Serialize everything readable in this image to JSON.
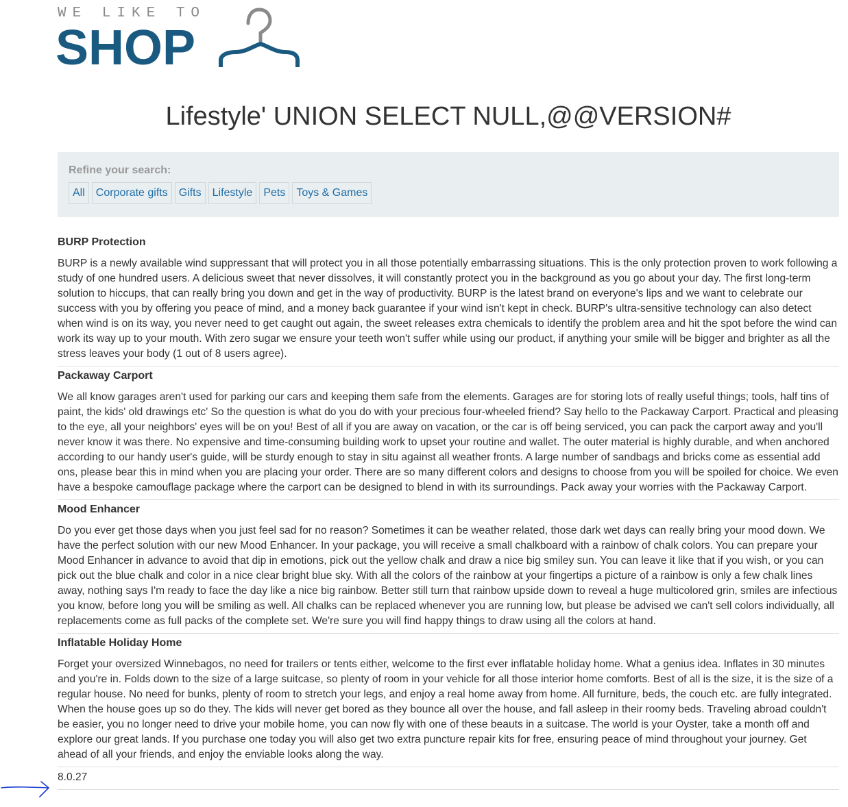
{
  "logo": {
    "tagline": "WE LIKE TO",
    "word": "SHOP"
  },
  "page_title": "Lifestyle' UNION SELECT NULL,@@VERSION#",
  "filter": {
    "heading": "Refine your search:",
    "categories": [
      "All",
      "Corporate gifts",
      "Gifts",
      "Lifestyle",
      "Pets",
      "Toys & Games"
    ]
  },
  "products": [
    {
      "name": "BURP Protection",
      "description": "BURP is a newly available wind suppressant that will protect you in all those potentially embarrassing situations. This is the only protection proven to work following a study of one hundred users. A delicious sweet that never dissolves, it will constantly protect you in the background as you go about your day. The first long-term solution to hiccups, that can really bring you down and get in the way of productivity. BURP is the latest brand on everyone's lips and we want to celebrate our success with you by offering you peace of mind, and a money back guarantee if your wind isn't kept in check. BURP's ultra-sensitive technology can also detect when wind is on its way, you never need to get caught out again, the sweet releases extra chemicals to identify the problem area and hit the spot before the wind can work its way up to your mouth. With zero sugar we ensure your teeth won't suffer while using our product, if anything your smile will be bigger and brighter as all the stress leaves your body (1 out of 8 users agree)."
    },
    {
      "name": "Packaway Carport",
      "description": "We all know garages aren't used for parking our cars and keeping them safe from the elements. Garages are for storing lots of really useful things; tools, half tins of paint, the kids' old drawings etc' So the question is what do you do with your precious four-wheeled friend? Say hello to the Packaway Carport. Practical and pleasing to the eye, all your neighbors' eyes will be on you! Best of all if you are away on vacation, or the car is off being serviced, you can pack the carport away and you'll never know it was there. No expensive and time-consuming building work to upset your routine and wallet. The outer material is highly durable, and when anchored according to our handy user's guide, will be sturdy enough to stay in situ against all weather fronts. A large number of sandbags and bricks come as essential add ons, please bear this in mind when you are placing your order. There are so many different colors and designs to choose from you will be spoiled for choice. We even have a bespoke camouflage package where the carport can be designed to blend in with its surroundings. Pack away your worries with the Packaway Carport."
    },
    {
      "name": "Mood Enhancer",
      "description": "Do you ever get those days when you just feel sad for no reason? Sometimes it can be weather related, those dark wet days can really bring your mood down. We have the perfect solution with our new Mood Enhancer. In your package, you will receive a small chalkboard with a rainbow of chalk colors. You can prepare your Mood Enhancer in advance to avoid that dip in emotions, pick out the yellow chalk and draw a nice big smiley sun. You can leave it like that if you wish, or you can pick out the blue chalk and color in a nice clear bright blue sky. With all the colors of the rainbow at your fingertips a picture of a rainbow is only a few chalk lines away, nothing says I'm ready to face the day like a nice big rainbow. Better still turn that rainbow upside down to reveal a huge multicolored grin, smiles are infectious you know, before long you will be smiling as well. All chalks can be replaced whenever you are running low, but please be advised we can't sell colors individually, all replacements come as full packs of the complete set. We're sure you will find happy things to draw using all the colors at hand."
    },
    {
      "name": "Inflatable Holiday Home",
      "description": "Forget your oversized Winnebagos, no need for trailers or tents either, welcome to the first ever inflatable holiday home. What a genius idea. Inflates in 30 minutes and you're in. Folds down to the size of a large suitcase, so plenty of room in your vehicle for all those interior home comforts. Best of all is the size, it is the size of a regular house. No need for bunks, plenty of room to stretch your legs, and enjoy a real home away from home. All furniture, beds, the couch etc. are fully integrated. When the house goes up so do they. The kids will never get bored as they bounce all over the house, and fall asleep in their roomy beds. Traveling abroad couldn't be easier, you no longer need to drive your mobile home, you can now fly with one of these beauts in a suitcase. The world is your Oyster, take a month off and explore our great lands. If you purchase one today you will also get two extra puncture repair kits for free, ensuring peace of mind throughout your journey. Get ahead of all your friends, and enjoy the enviable looks along the way."
    }
  ],
  "version_row": "8.0.27",
  "colors": {
    "brand": "#1a5a80",
    "link": "#1f6ea8",
    "filter_bg": "#e9eef0",
    "annotation_arrow": "#1b3fd1"
  }
}
